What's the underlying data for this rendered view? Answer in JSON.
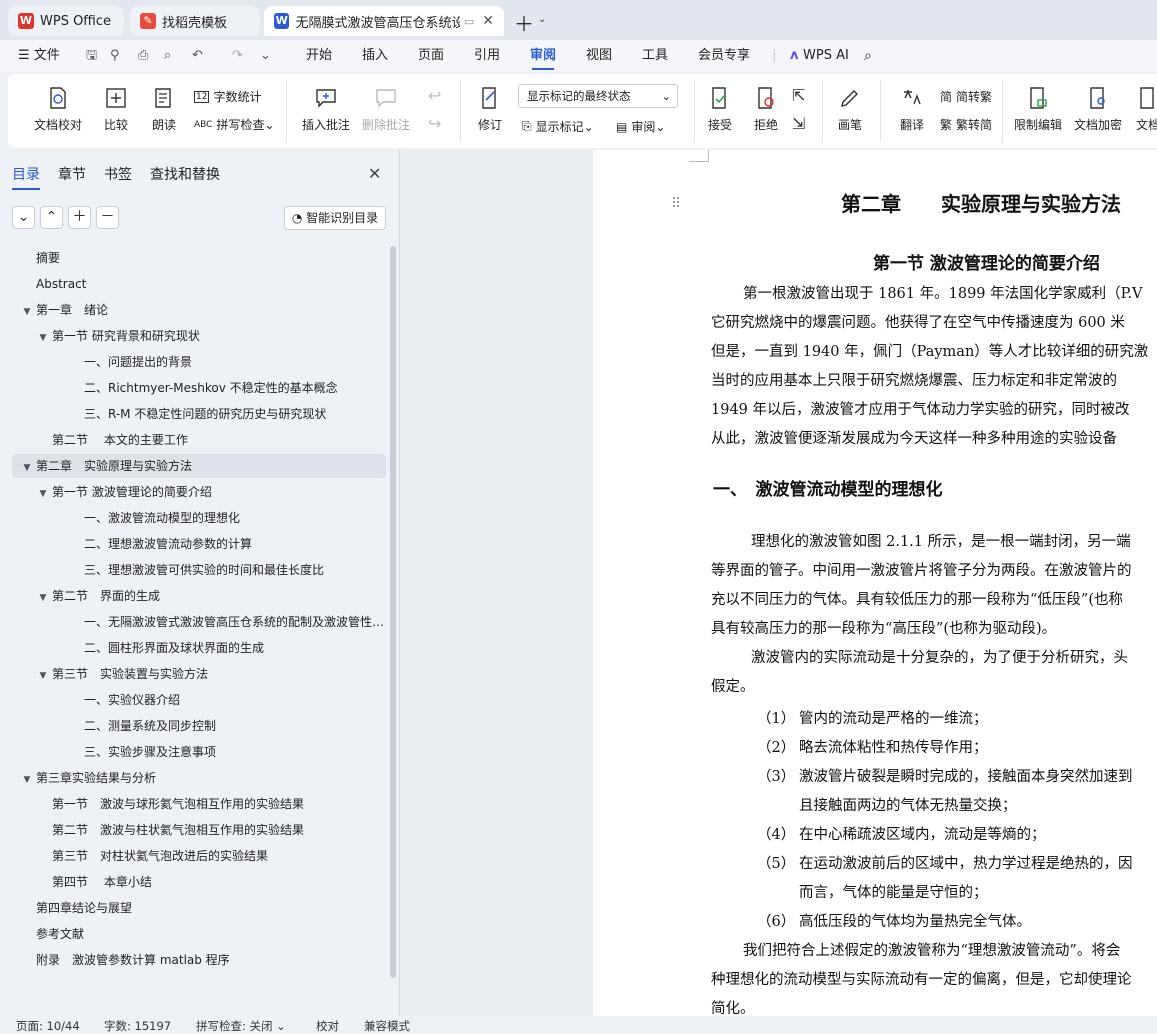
{
  "tabs": [
    {
      "label": "WPS Office"
    },
    {
      "label": "找稻壳模板"
    },
    {
      "label": "无隔膜式激波管高压仓系统设"
    }
  ],
  "menu": {
    "file": "文件",
    "items": [
      "开始",
      "插入",
      "页面",
      "引用",
      "审阅",
      "视图",
      "工具",
      "会员专享"
    ],
    "selected": "审阅",
    "ai": "WPS AI"
  },
  "ribbon": {
    "doc_check": "文档校对",
    "compare": "比较",
    "read": "朗读",
    "word_count": "字数统计",
    "spell_check": "拼写检查",
    "insert_comment": "插入批注",
    "delete_comment": "删除批注",
    "revise": "修订",
    "show_markup": "显示标记",
    "display_state": "显示标记的最终状态",
    "review": "审阅",
    "accept": "接受",
    "reject": "拒绝",
    "pen": "画笔",
    "translate": "翻译",
    "to_trad": "简转繁",
    "to_simp": "繁转简",
    "restrict": "限制编辑",
    "encrypt": "文档加密",
    "doc_more": "文档"
  },
  "nav": {
    "tabs": [
      "目录",
      "章节",
      "书签",
      "查找和替换"
    ],
    "smart_toc": "智能识别目录",
    "items": [
      {
        "text": "摘要",
        "level": 0,
        "tw": ""
      },
      {
        "text": "Abstract",
        "level": 0,
        "tw": ""
      },
      {
        "text": "第一章　绪论",
        "level": 0,
        "tw": "▼"
      },
      {
        "text": "第一节  研究背景和研究现状",
        "level": 1,
        "tw": "▼"
      },
      {
        "text": "一、问题提出的背景",
        "level": 2,
        "tw": ""
      },
      {
        "text": "二、Richtmyer-Meshkov 不稳定性的基本概念",
        "level": 2,
        "tw": ""
      },
      {
        "text": "三、R-M 不稳定性问题的研究历史与研究现状",
        "level": 2,
        "tw": ""
      },
      {
        "text": "第二节　 本文的主要工作",
        "level": 1,
        "tw": ""
      },
      {
        "text": "第二章　实验原理与实验方法",
        "level": 0,
        "tw": "▼",
        "highlight": true
      },
      {
        "text": "第一节 激波管理论的简要介绍",
        "level": 1,
        "tw": "▼"
      },
      {
        "text": "一、激波管流动模型的理想化",
        "level": 2,
        "tw": ""
      },
      {
        "text": "二、理想激波管流动参数的计算",
        "level": 2,
        "tw": ""
      },
      {
        "text": "三、理想激波管可供实验的时间和最佳长度比",
        "level": 2,
        "tw": ""
      },
      {
        "text": "第二节　界面的生成",
        "level": 1,
        "tw": "▼"
      },
      {
        "text": "一、无隔激波管式激波管高压仓系统的配制及激波管性能测试",
        "level": 2,
        "tw": ""
      },
      {
        "text": "二、圆柱形界面及球状界面的生成",
        "level": 2,
        "tw": ""
      },
      {
        "text": "第三节　实验装置与实验方法",
        "level": 1,
        "tw": "▼"
      },
      {
        "text": "一、实验仪器介绍",
        "level": 2,
        "tw": ""
      },
      {
        "text": "二、测量系统及同步控制",
        "level": 2,
        "tw": ""
      },
      {
        "text": "三、实验步骤及注意事项",
        "level": 2,
        "tw": ""
      },
      {
        "text": "第三章实验结果与分析",
        "level": 0,
        "tw": "▼"
      },
      {
        "text": "第一节　激波与球形氦气泡相互作用的实验结果",
        "level": 1,
        "tw": ""
      },
      {
        "text": "第二节　激波与柱状氦气泡相互作用的实验结果",
        "level": 1,
        "tw": ""
      },
      {
        "text": "第三节　对柱状氦气泡改进后的实验结果",
        "level": 1,
        "tw": ""
      },
      {
        "text": "第四节　 本章小结",
        "level": 1,
        "tw": ""
      },
      {
        "text": "第四章结论与展望",
        "level": 0,
        "tw": ""
      },
      {
        "text": "参考文献",
        "level": 0,
        "tw": ""
      },
      {
        "text": "附录　激波管参数计算 matlab 程序",
        "level": 0,
        "tw": ""
      }
    ]
  },
  "doc": {
    "chapter_title": "第二章　　实验原理与实验方法",
    "section_title": "第一节  激波管理论的简要介绍",
    "lines": [
      "第一根激波管出现于 1861 年。1899 年法国化学家威利（P.V",
      "它研究燃烧中的爆震问题。他获得了在空气中传播速度为 600 米",
      "但是，一直到 1940 年，佩门（Payman）等人才比较详细的研究激",
      "当时的应用基本上只限于研究燃烧爆震、压力标定和非定常波的",
      "1949 年以后，激波管才应用于气体动力学实验的研究，同时被改",
      "从此，激波管便逐渐发展成为今天这样一种多种用途的实验设备"
    ],
    "subheading": "一、　激波管流动模型的理想化",
    "lines2": [
      "理想化的激波管如图 2.1.1 所示，是一根一端封闭，另一端",
      "等界面的管子。中间用一激波管片将管子分为两段。在激波管片的",
      "充以不同压力的气体。具有较低压力的那一段称为“低压段”(也称",
      "具有较高压力的那一段称为“高压段”(也称为驱动段)。",
      "激波管内的实际流动是十分复杂的，为了便于分析研究，头",
      "假定。"
    ],
    "list": [
      {
        "num": "（1）",
        "text": "管内的流动是严格的一维流；"
      },
      {
        "num": "（2）",
        "text": "略去流体粘性和热传导作用；"
      },
      {
        "num": "（3）",
        "text": "激波管片破裂是瞬时完成的，接触面本身突然加速到"
      },
      {
        "num": "",
        "text": "且接触面两边的气体无热量交换；"
      },
      {
        "num": "（4）",
        "text": "在中心稀疏波区域内，流动是等熵的；"
      },
      {
        "num": "（5）",
        "text": "在运动激波前后的区域中，热力学过程是绝热的，因"
      },
      {
        "num": "",
        "text": "而言，气体的能量是守恒的；"
      },
      {
        "num": "（6）",
        "text": "高低压段的气体均为量热完全气体。"
      }
    ],
    "lines3": [
      "我们把符合上述假定的激波管称为“理想激波管流动”。将会",
      "种理想化的流动模型与实际流动有一定的偏离，但是，它却使理论",
      "简化。"
    ]
  },
  "status": {
    "page": "页面: 10/44",
    "words": "字数: 15197",
    "spell": "拼写检查: 关闭",
    "proof": "校对",
    "compat": "兼容模式"
  }
}
